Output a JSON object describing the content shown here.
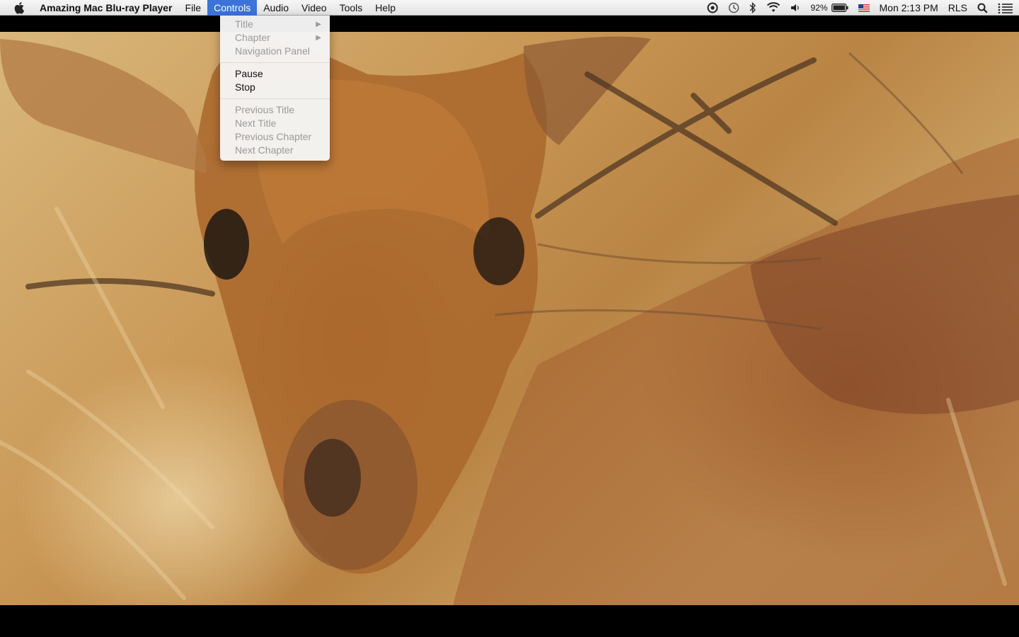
{
  "menubar": {
    "app_name": "Amazing Mac Blu-ray Player",
    "menus": [
      "File",
      "Controls",
      "Audio",
      "Video",
      "Tools",
      "Help"
    ],
    "active_menu": "Controls",
    "status": {
      "battery_percent": "92%",
      "clock": "Mon 2:13 PM",
      "user": "RLS",
      "icons": [
        "screen-recorder-icon",
        "time-machine-icon",
        "bluetooth-icon",
        "wifi-icon",
        "volume-icon",
        "battery-icon",
        "us-flag-icon",
        "spotlight-icon",
        "notification-center-icon"
      ]
    }
  },
  "dropdown": {
    "groups": [
      [
        {
          "label": "Title",
          "enabled": false,
          "submenu": true
        },
        {
          "label": "Chapter",
          "enabled": false,
          "submenu": true
        },
        {
          "label": "Navigation Panel",
          "enabled": false,
          "submenu": false
        }
      ],
      [
        {
          "label": "Pause",
          "enabled": true,
          "submenu": false
        },
        {
          "label": "Stop",
          "enabled": true,
          "submenu": false
        }
      ],
      [
        {
          "label": "Previous Title",
          "enabled": false,
          "submenu": false
        },
        {
          "label": "Next Title",
          "enabled": false,
          "submenu": false
        },
        {
          "label": "Previous Chapter",
          "enabled": false,
          "submenu": false
        },
        {
          "label": "Next Chapter",
          "enabled": false,
          "submenu": false
        }
      ]
    ]
  },
  "colors": {
    "menu_highlight": "#3b73d8",
    "disabled_text": "#9a9a9a",
    "letterbox": "#000000"
  }
}
